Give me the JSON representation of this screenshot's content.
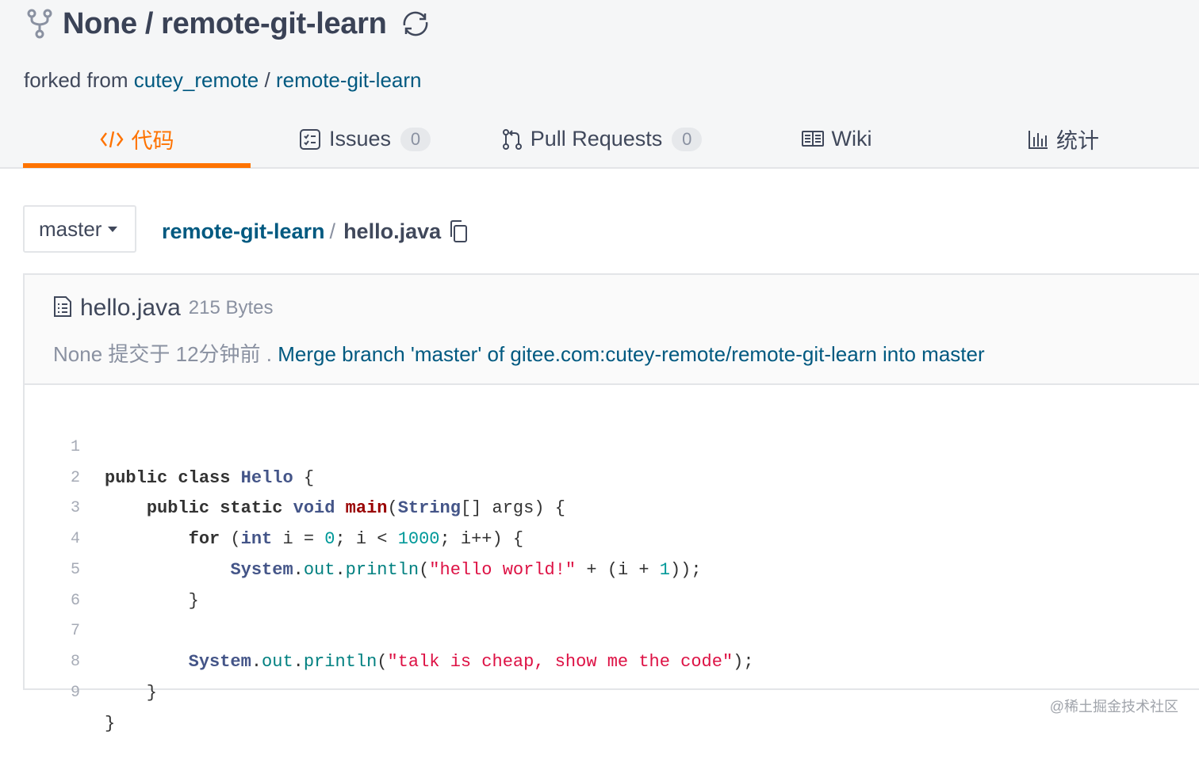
{
  "repo": {
    "owner": "None",
    "slash": "/",
    "name": "remote-git-learn",
    "forked_prefix": "forked from",
    "forked_owner": "cutey_remote",
    "forked_sep": "/",
    "forked_repo": "remote-git-learn"
  },
  "tabs": [
    {
      "label": "代码",
      "icon": "code-icon",
      "active": true
    },
    {
      "label": "Issues",
      "icon": "issues-icon",
      "count": "0"
    },
    {
      "label": "Pull Requests",
      "icon": "pull-request-icon",
      "count": "0"
    },
    {
      "label": "Wiki",
      "icon": "book-icon"
    },
    {
      "label": "统计",
      "icon": "bar-chart-icon"
    }
  ],
  "branch": {
    "label": "master"
  },
  "breadcrumb": {
    "repo": "remote-git-learn",
    "sep": "/",
    "file": "hello.java"
  },
  "file": {
    "name": "hello.java",
    "size": "215 Bytes",
    "commit_author": "None",
    "commit_meta": "提交于 12分钟前",
    "commit_dot": ".",
    "commit_message": "Merge branch 'master' of gitee.com:cutey-remote/remote-git-learn into master"
  },
  "code": {
    "line_numbers": [
      "1",
      "2",
      "3",
      "4",
      "5",
      "6",
      "7",
      "8",
      "9"
    ],
    "lines": [
      "public class Hello {",
      "    public static void main(String[] args) {",
      "        for (int i = 0; i < 1000; i++) {",
      "            System.out.println(\"hello world!\" + (i + 1));",
      "        }",
      "",
      "        System.out.println(\"talk is cheap, show me the code\");",
      "    }",
      "}"
    ]
  },
  "colors": {
    "accent": "#fe7300",
    "link": "#005980"
  },
  "watermark": "@稀土掘金技术社区"
}
